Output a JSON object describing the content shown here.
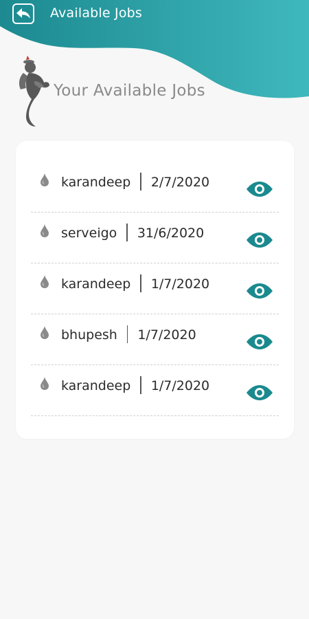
{
  "header": {
    "title": "Available Jobs",
    "accent_color": "#1a8a8f"
  },
  "section": {
    "title": "Your Available Jobs"
  },
  "jobs": [
    {
      "name": "karandeep",
      "date": "2/7/2020",
      "action_icon": "eye-icon"
    },
    {
      "name": "serveigo",
      "date": "31/6/2020",
      "action_icon": "eye-icon"
    },
    {
      "name": "karandeep",
      "date": "1/7/2020",
      "action_icon": "eye-icon"
    },
    {
      "name": "bhupesh",
      "date": "1/7/2020",
      "action_icon": "eye-icon"
    },
    {
      "name": "karandeep",
      "date": "1/7/2020",
      "action_icon": "eye-icon"
    }
  ]
}
